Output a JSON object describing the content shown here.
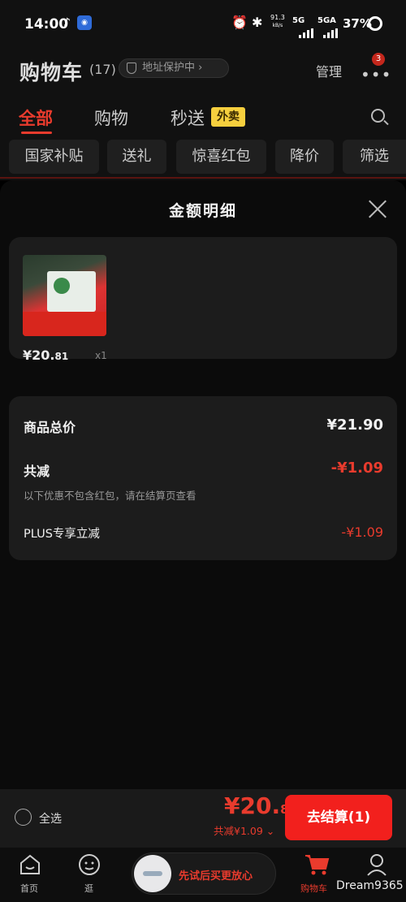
{
  "status_bar": {
    "time": "14:00",
    "speed": "91.3",
    "speed_unit": "kB/s",
    "net1": "5G",
    "net2": "5GA",
    "battery": "37%"
  },
  "header": {
    "title": "购物车",
    "count": "(17)",
    "address_protect": "地址保护中 ›",
    "manage": "管理",
    "more_badge": "3"
  },
  "tabs": [
    {
      "label": "全部"
    },
    {
      "label": "购物"
    },
    {
      "label": "秒送"
    }
  ],
  "tab_tag": "外卖",
  "chips": [
    "国家补贴",
    "送礼",
    "惊喜红包",
    "降价",
    "筛选"
  ],
  "sheet": {
    "title": "金额明细",
    "product": {
      "price_int": "¥20.",
      "price_dec": "81",
      "qty": "x1"
    },
    "rows": {
      "total_label": "商品总价",
      "total_value": "¥21.90",
      "reduce_label": "共减",
      "reduce_value": "-¥1.09",
      "note": "以下优惠不包含红包，请在结算页查看",
      "plus_label": "PLUS专享立减",
      "plus_value": "-¥1.09"
    }
  },
  "bottom": {
    "select_all": "全选",
    "total_int": "¥20.",
    "total_dec": "81",
    "discount": "共减¥1.09 ⌄",
    "checkout": "去结算(1)"
  },
  "nav": {
    "home": "首页",
    "browse": "逛",
    "promo": "先试后买更放心",
    "cart": "购物车",
    "watermark": "Dream9365"
  },
  "colors": {
    "accent": "#e93b2d",
    "tag_yellow": "#f6cf3e",
    "checkout_red": "#f2201d"
  }
}
